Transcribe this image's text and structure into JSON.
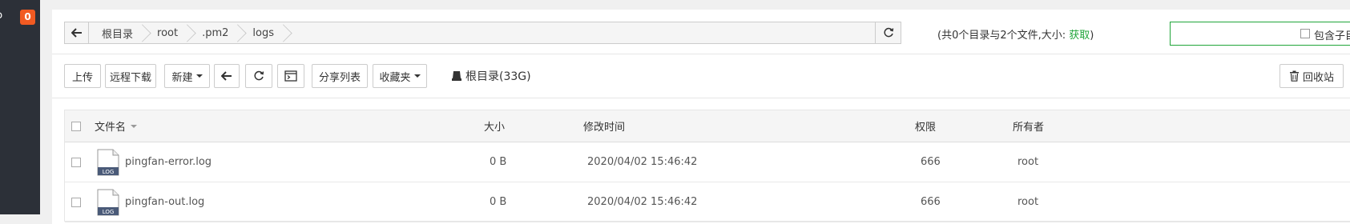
{
  "sidebar": {
    "partial_glyph": "ၣ",
    "badge": "0"
  },
  "path": {
    "crumbs": [
      "根目录",
      "root",
      ".pm2",
      "logs"
    ]
  },
  "dirinfo": {
    "text": "(共0个目录与2个文件,大小:",
    "link": "获取",
    "close": ")"
  },
  "search": {
    "include_sub_label": "包含子目"
  },
  "toolbar": {
    "upload": "上传",
    "remote_download": "远程下载",
    "new": "新建",
    "share_list": "分享列表",
    "favorites": "收藏夹",
    "disk": "根目录(33G)",
    "recycle": "回收站"
  },
  "table": {
    "headers": {
      "name": "文件名",
      "size": "大小",
      "mtime": "修改时间",
      "perm": "权限",
      "owner": "所有者"
    },
    "rows": [
      {
        "name": "pingfan-error.log",
        "size": "0 B",
        "mtime": "2020/04/02 15:46:42",
        "perm": "666",
        "owner": "root",
        "icon_label": "LOG"
      },
      {
        "name": "pingfan-out.log",
        "size": "0 B",
        "mtime": "2020/04/02 15:46:42",
        "perm": "666",
        "owner": "root",
        "icon_label": "LOG"
      }
    ]
  },
  "colors": {
    "accent": "#20a53a",
    "badge": "#f15a22",
    "sidebar": "#2c3038"
  }
}
